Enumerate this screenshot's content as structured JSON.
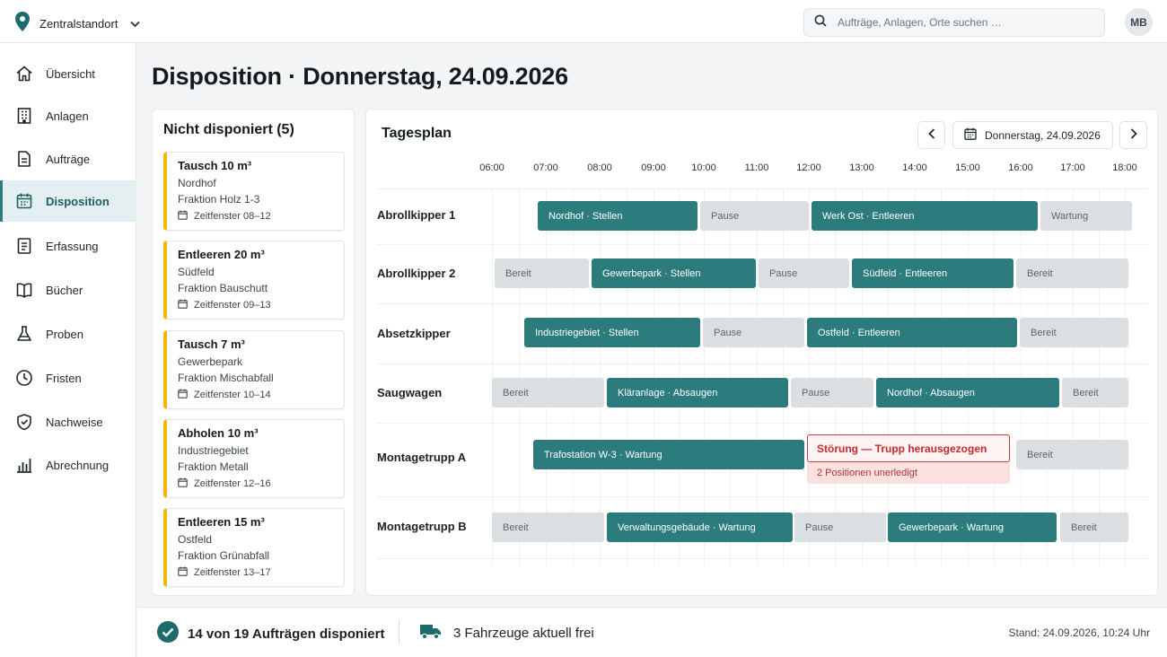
{
  "topbar": {
    "location_label": "Zentralstandort",
    "search_placeholder": "Aufträge, Anlagen, Orte suchen …",
    "user_initials": "MB"
  },
  "sidebar": {
    "items": [
      {
        "label": "Übersicht",
        "icon": "home-icon"
      },
      {
        "label": "Anlagen",
        "icon": "building-icon"
      },
      {
        "label": "Aufträge",
        "icon": "document-icon"
      },
      {
        "label": "Disposition",
        "icon": "calendar-icon",
        "active": true
      },
      {
        "label": "Erfassung",
        "icon": "form-icon"
      },
      {
        "label": "Bücher",
        "icon": "book-icon"
      },
      {
        "label": "Proben",
        "icon": "flask-icon"
      },
      {
        "label": "Fristen",
        "icon": "clock-icon"
      },
      {
        "label": "Nachweise",
        "icon": "shield-icon"
      },
      {
        "label": "Abrechnung",
        "icon": "bar-chart-icon"
      }
    ]
  },
  "page": {
    "title": "Disposition · Donnerstag, 24.09.2026"
  },
  "unassigned": {
    "title": "Nicht disponiert (5)",
    "jobs": [
      {
        "title": "Tausch 10 m³",
        "place": "Nordhof",
        "fraction": "Fraktion Holz 1-3",
        "window": "Zeitfenster 08–12"
      },
      {
        "title": "Entleeren 20 m³",
        "place": "Südfeld",
        "fraction": "Fraktion Bauschutt",
        "window": "Zeitfenster 09–13"
      },
      {
        "title": "Tausch 7 m³",
        "place": "Gewerbepark",
        "fraction": "Fraktion Mischabfall",
        "window": "Zeitfenster 10–14"
      },
      {
        "title": "Abholen 10 m³",
        "place": "Industriegebiet",
        "fraction": "Fraktion Metall",
        "window": "Zeitfenster 12–16"
      },
      {
        "title": "Entleeren 15 m³",
        "place": "Ostfeld",
        "fraction": "Fraktion Grünabfall",
        "window": "Zeitfenster 13–17"
      }
    ]
  },
  "plan": {
    "title": "Tagesplan",
    "date_label": "Donnerstag, 24.09.2026",
    "hours": [
      "06:00",
      "07:00",
      "08:00",
      "09:00",
      "10:00",
      "11:00",
      "12:00",
      "13:00",
      "14:00",
      "15:00",
      "16:00",
      "17:00",
      "18:00"
    ],
    "rows": [
      {
        "name": "Abrollkipper 1",
        "blocks": [
          {
            "label": "Nordhof · Stellen",
            "kind": "job"
          },
          {
            "label": "Pause",
            "kind": "idle"
          },
          {
            "label": "Werk Ost · Entleeren",
            "kind": "job"
          },
          {
            "label": "Wartung",
            "kind": "idle"
          }
        ]
      },
      {
        "name": "Abrollkipper 2",
        "blocks": [
          {
            "label": "Bereit",
            "kind": "idle"
          },
          {
            "label": "Gewerbepark · Stellen",
            "kind": "job"
          },
          {
            "label": "Pause",
            "kind": "idle"
          },
          {
            "label": "Südfeld · Entleeren",
            "kind": "job"
          },
          {
            "label": "Bereit",
            "kind": "idle"
          }
        ]
      },
      {
        "name": "Absetzkipper",
        "blocks": [
          {
            "label": "Industriegebiet · Stellen",
            "kind": "job"
          },
          {
            "label": "Pause",
            "kind": "idle"
          },
          {
            "label": "Ostfeld · Entleeren",
            "kind": "job"
          },
          {
            "label": "Bereit",
            "kind": "idle"
          }
        ]
      },
      {
        "name": "Saugwagen",
        "blocks": [
          {
            "label": "Bereit",
            "kind": "idle"
          },
          {
            "label": "Kläranlage · Absaugen",
            "kind": "job"
          },
          {
            "label": "Pause",
            "kind": "idle"
          },
          {
            "label": "Nordhof · Absaugen",
            "kind": "job"
          },
          {
            "label": "Bereit",
            "kind": "idle"
          }
        ]
      },
      {
        "name": "Montagetrupp A",
        "blocks": [
          {
            "label": "Trafostation W-3 · Wartung",
            "kind": "job"
          },
          {
            "label": "Bereit",
            "kind": "idle"
          }
        ],
        "fault": {
          "title": "Störung — Trupp herausgezogen",
          "note": "2 Positionen unerledigt"
        }
      },
      {
        "name": "Montagetrupp B",
        "blocks": [
          {
            "label": "Bereit",
            "kind": "idle"
          },
          {
            "label": "Verwaltungsgebäude · Wartung",
            "kind": "job"
          },
          {
            "label": "Pause",
            "kind": "idle"
          },
          {
            "label": "Gewerbepark · Wartung",
            "kind": "job"
          },
          {
            "label": "Bereit",
            "kind": "idle"
          }
        ]
      }
    ]
  },
  "footer": {
    "assigned_text": "14 von 19 Aufträgen disponiert",
    "free_text": "3 Fahrzeuge aktuell frei",
    "stand_text": "Stand: 24.09.2026, 10:24 Uhr"
  },
  "colors": {
    "accent": "#2c7c7d",
    "idle": "#dcdfe2",
    "warning": "#f2b705",
    "fault": "#d23a3a"
  }
}
